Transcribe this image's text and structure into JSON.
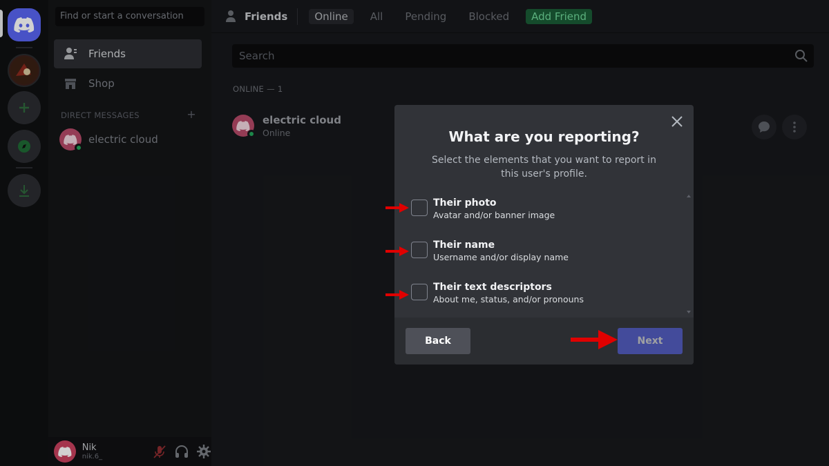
{
  "sidebar": {
    "search_placeholder": "Find or start a conversation",
    "nav_friends": "Friends",
    "nav_shop": "Shop",
    "dm_header": "DIRECT MESSAGES",
    "dm_add": "+",
    "dm_user": "electric cloud"
  },
  "userbar": {
    "name": "Nik",
    "tag": "nik.6_"
  },
  "topbar": {
    "title": "Friends",
    "tabs": [
      "Online",
      "All",
      "Pending",
      "Blocked"
    ],
    "add_friend": "Add Friend"
  },
  "main": {
    "search_placeholder": "Search",
    "online_count": "ONLINE — 1",
    "friend": {
      "name": "electric cloud",
      "status": "Online"
    }
  },
  "modal": {
    "title": "What are you reporting?",
    "subtitle": "Select the elements that you want to report in this user's profile.",
    "options": [
      {
        "title": "Their photo",
        "desc": "Avatar and/or banner image"
      },
      {
        "title": "Their name",
        "desc": "Username and/or display name"
      },
      {
        "title": "Their text descriptors",
        "desc": "About me, status, and/or pronouns"
      }
    ],
    "back_label": "Back",
    "next_label": "Next"
  },
  "colors": {
    "accent": "#5865f2",
    "online": "#23a55a",
    "annotation_arrow": "#e00000"
  }
}
